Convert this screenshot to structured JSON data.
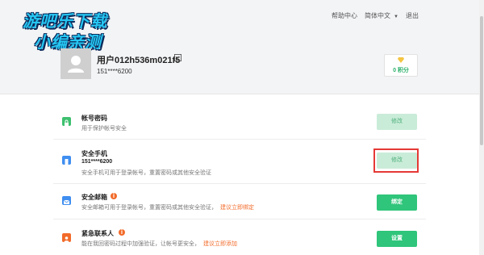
{
  "watermark": {
    "line1": "游吧乐下载",
    "line2": "小编亲测"
  },
  "nav": {
    "help": "帮助中心",
    "language": "简体中文",
    "exit": "退出"
  },
  "user": {
    "name": "用户012h536m021f5",
    "phone": "151****6200"
  },
  "points": {
    "label": "0 积分"
  },
  "rows": [
    {
      "title": "帐号密码",
      "subtitle": "用于保护帐号安全",
      "button": "修改"
    },
    {
      "title": "安全手机",
      "value": "151****6200",
      "subtitle": "安全手机可用于登录帐号，重置密码或其他安全验证",
      "button": "修改"
    },
    {
      "title": "安全邮箱",
      "subtitle": "安全邮箱可用于登录帐号，重置密码或其他安全验证，",
      "link": "建议立即绑定",
      "button": "绑定"
    },
    {
      "title": "紧急联系人",
      "subtitle": "能在我回密码过程中加强验证，让帐号更安全，",
      "link": "建议立即添加",
      "button": "设置"
    }
  ],
  "colors": {
    "accent_green": "#2fc57a",
    "light_green": "#c9ecd8",
    "warning_orange": "#f26b2a",
    "highlight_red": "#e53935"
  },
  "icons": [
    "lock-icon",
    "phone-icon",
    "mail-icon",
    "contact-icon",
    "edit-icon",
    "diamond-icon",
    "avatar-icon",
    "chevron-down-icon"
  ]
}
